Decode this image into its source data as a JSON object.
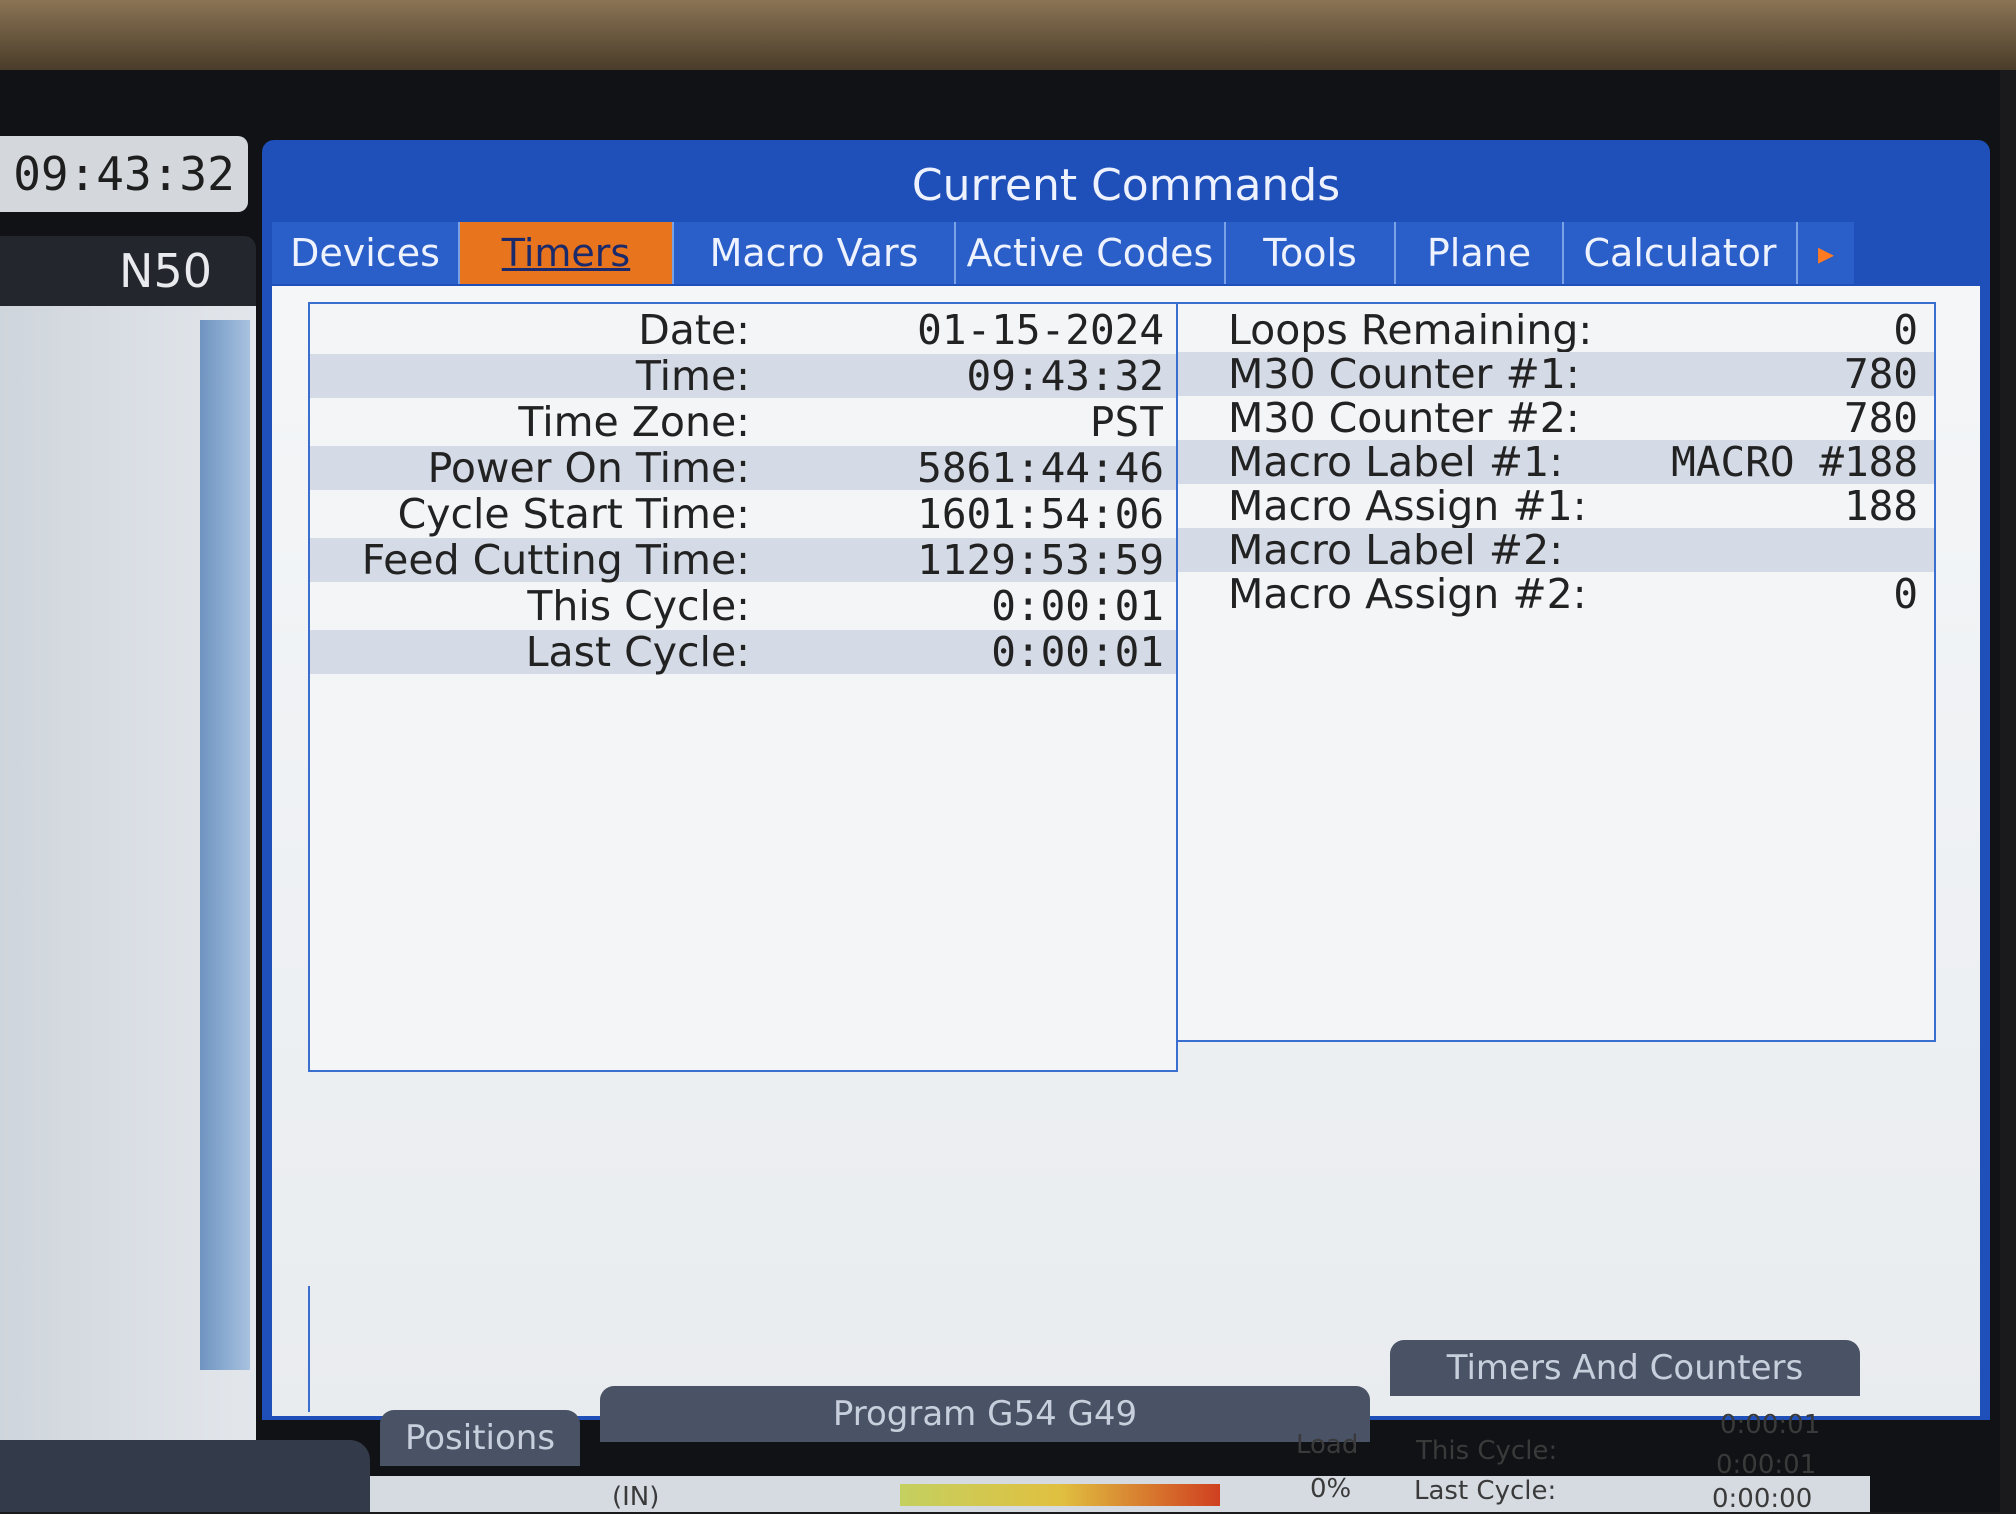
{
  "clock": "09:43:32",
  "line_number": "N50",
  "window_title": "Current Commands",
  "tabs": [
    {
      "label": "Devices",
      "active": false
    },
    {
      "label": "Timers",
      "active": true
    },
    {
      "label": "Macro Vars",
      "active": false
    },
    {
      "label": "Active Codes",
      "active": false
    },
    {
      "label": "Tools",
      "active": false
    },
    {
      "label": "Plane",
      "active": false
    },
    {
      "label": "Calculator",
      "active": false
    }
  ],
  "timers": [
    {
      "label": "Date:",
      "value": "01-15-2024"
    },
    {
      "label": "Time:",
      "value": "09:43:32"
    },
    {
      "label": "Time Zone:",
      "value": "PST"
    },
    {
      "label": "Power On Time:",
      "value": "5861:44:46"
    },
    {
      "label": "Cycle Start Time:",
      "value": "1601:54:06"
    },
    {
      "label": "Feed Cutting Time:",
      "value": "1129:53:59"
    },
    {
      "label": "This Cycle:",
      "value": "0:00:01"
    },
    {
      "label": "Last Cycle:",
      "value": "0:00:01"
    }
  ],
  "counters": [
    {
      "label": "Loops Remaining:",
      "value": "0"
    },
    {
      "label": "M30 Counter #1:",
      "value": "780"
    },
    {
      "label": "M30 Counter #2:",
      "value": "780"
    },
    {
      "label": "Macro Label #1:",
      "value": "MACRO #188"
    },
    {
      "label": "Macro Assign #1:",
      "value": "188"
    },
    {
      "label": "Macro Label #2:",
      "value": ""
    },
    {
      "label": "Macro Assign #2:",
      "value": "0"
    }
  ],
  "bottom": {
    "positions_label": "Positions",
    "program_label": "Program G54 G49",
    "timers_counters_label": "Timers And Counters",
    "units": "(IN)",
    "load_label": "Load",
    "load_value": "0%",
    "this_cycle_label": "This Cycle:",
    "this_cycle_value": "0:00:01",
    "last_cycle_label": "Last Cycle:",
    "last_cycle_value": "0:00:01",
    "third_value": "0:00:00"
  },
  "colors": {
    "window_blue": "#1f4fb8",
    "active_tab": "#e8741e",
    "row_shade": "#d4dbe6"
  }
}
